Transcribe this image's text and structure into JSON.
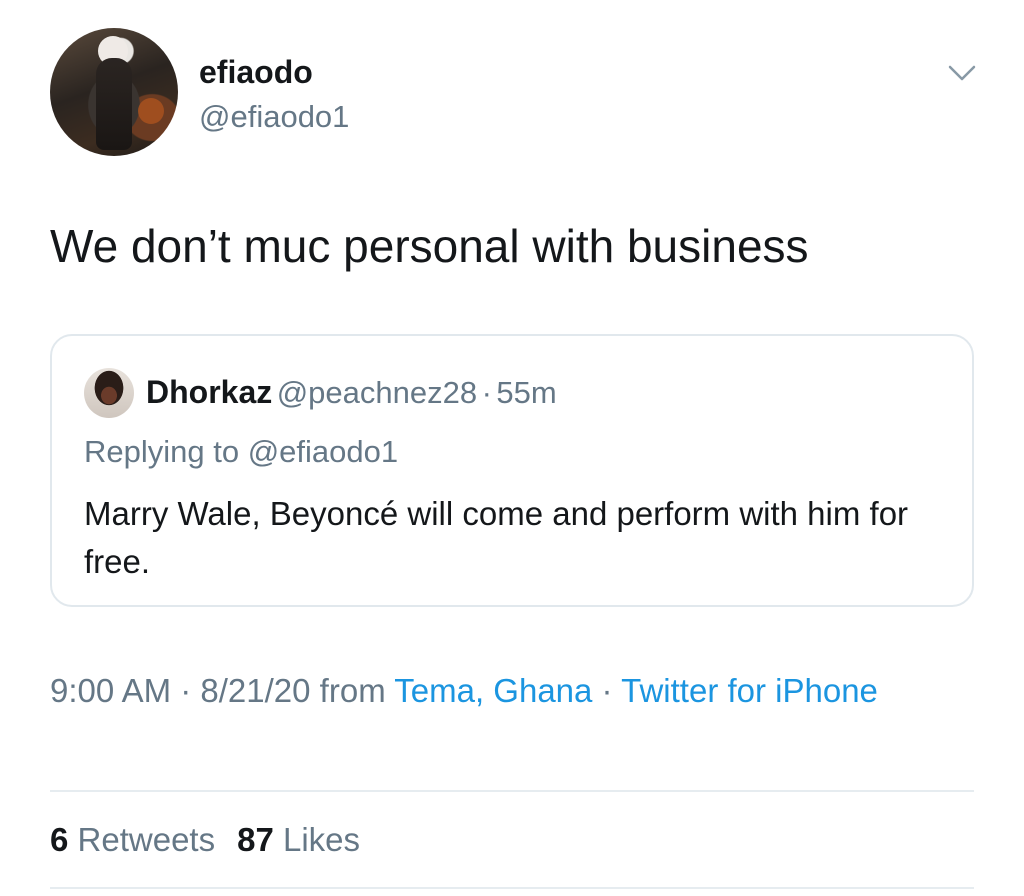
{
  "author": {
    "display_name": "efiaodo",
    "handle": "@efiaodo1"
  },
  "tweet": {
    "text": "We don’t muc personal with business"
  },
  "quoted_tweet": {
    "display_name": "Dhorkaz",
    "handle": "@peachnez28",
    "separator": "·",
    "time": "55m",
    "replying_to": "Replying to @efiaodo1",
    "text": "Marry Wale, Beyoncé will come and perform with him for free."
  },
  "meta": {
    "time": "9:00 AM",
    "sep1": " · ",
    "date": "8/21/20",
    "from": " from ",
    "location": "Tema, Ghana",
    "sep2": " · ",
    "source": "Twitter for iPhone"
  },
  "stats": {
    "retweets_count": "6",
    "retweets_label": "Retweets",
    "likes_count": "87",
    "likes_label": "Likes"
  },
  "colors": {
    "link_blue": "#1b95e0",
    "secondary_gray": "#657786",
    "border": "#e1e8ed"
  },
  "icons": {
    "menu": "chevron-down-icon"
  }
}
